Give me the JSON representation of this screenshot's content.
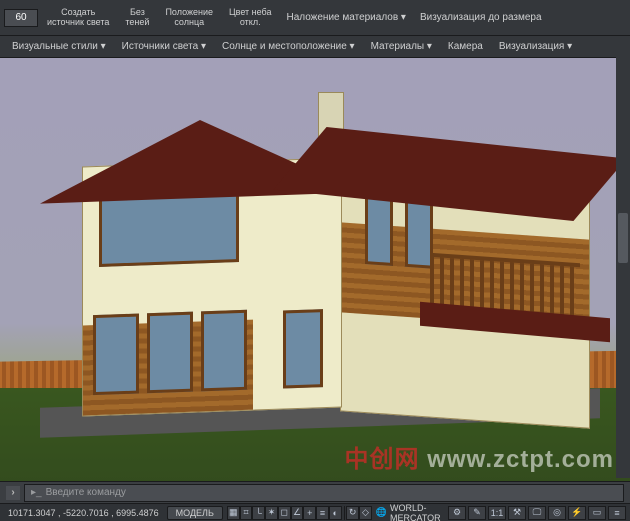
{
  "toolbar": {
    "number_field": "60",
    "buttons": [
      {
        "line1": "Создать",
        "line2": "источник света"
      },
      {
        "line1": "Без",
        "line2": "теней"
      },
      {
        "line1": "Положение",
        "line2": "солнца"
      },
      {
        "line1": "Цвет неба",
        "line2": "откл."
      }
    ],
    "panels": [
      {
        "label": "Наложение материалов ▾"
      },
      {
        "label": "Визуализация до размера"
      }
    ]
  },
  "ribbon_groups": {
    "visual_styles": "Визуальные стили ▾",
    "light_sources": "Источники света ▾",
    "sun_position": "Солнце и местоположение ▾",
    "materials": "Материалы ▾",
    "camera": "Камера",
    "visualization": "Визуализация ▾"
  },
  "watermark": {
    "cn": "中创网",
    "url": "www.zctpt.com"
  },
  "command": {
    "placeholder": "Введите команду"
  },
  "status": {
    "coords": "10171.3047 , -5220.7016 , 6995.4876",
    "space": "МОДЕЛЬ",
    "world": "WORLD-MERCATOR",
    "scale": "1:1"
  }
}
